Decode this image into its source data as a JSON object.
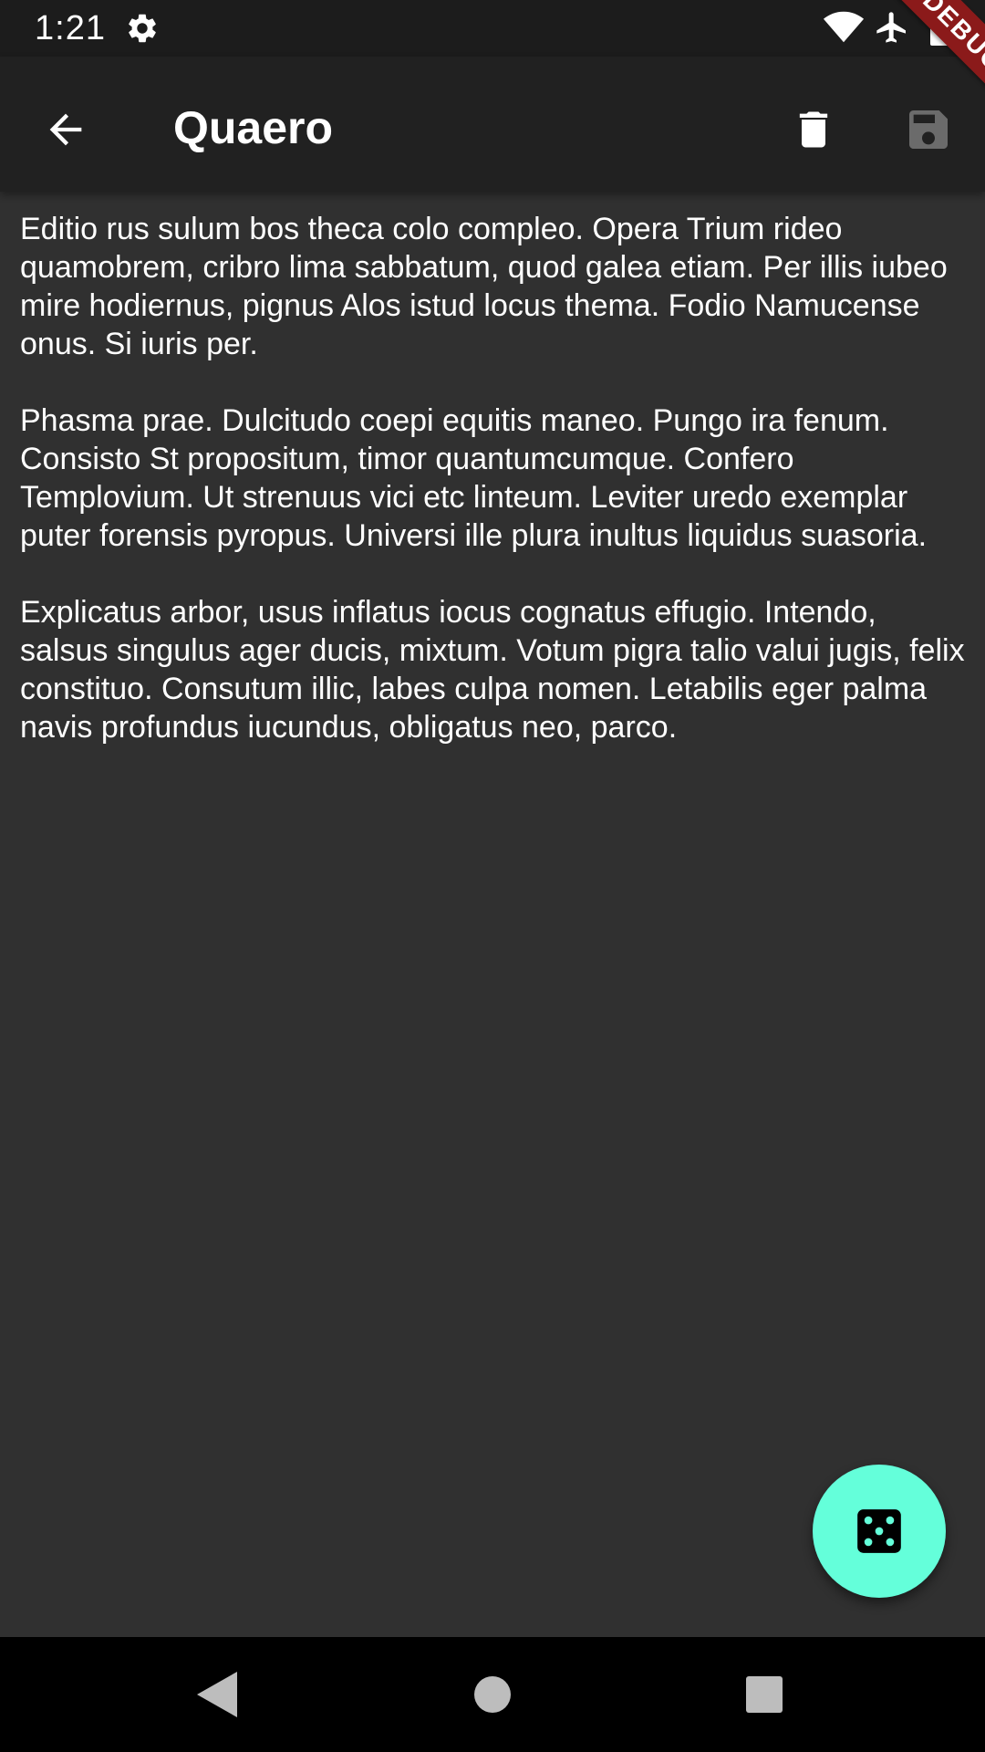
{
  "status_bar": {
    "time": "1:21",
    "icons": [
      "gear-icon",
      "wifi-icon",
      "airplane-icon",
      "battery-icon"
    ]
  },
  "debug_banner": {
    "label": "DEBUG"
  },
  "app_bar": {
    "title": "Quaero",
    "back_icon": "arrow-left-icon",
    "delete_icon": "trash-icon",
    "save_icon": "floppy-disk-icon"
  },
  "content": {
    "paragraphs": [
      "Editio rus sulum bos theca colo compleo. Opera Trium rideo quamobrem, cribro lima sabbatum, quod galea etiam. Per illis iubeo mire hodiernus, pignus Alos istud locus thema. Fodio Namucense onus. Si iuris per.",
      "Phasma prae. Dulcitudo coepi equitis maneo. Pungo ira fenum. Consisto St propositum, timor quantumcumque. Confero Templovium. Ut strenuus vici etc linteum. Leviter uredo exemplar puter forensis pyropus. Universi ille plura inultus liquidus suasoria.",
      "Explicatus arbor, usus inflatus iocus cognatus effugio. Intendo, salsus singulus ager ducis, mixtum. Votum pigra talio valui jugis, felix constituo. Consutum illic, labes culpa nomen. Letabilis eger palma navis profundus iucundus, obligatus neo, parco."
    ]
  },
  "fab": {
    "icon": "dice-five-icon"
  },
  "colors": {
    "background": "#303030",
    "app_bar": "#212121",
    "status_bar": "#1c1c1c",
    "accent": "#64ffda",
    "debug": "#8b1a1a",
    "save_disabled": "#6b6b6b"
  },
  "nav_bar": {
    "icons": [
      "nav-back-icon",
      "nav-home-icon",
      "nav-recents-icon"
    ]
  }
}
